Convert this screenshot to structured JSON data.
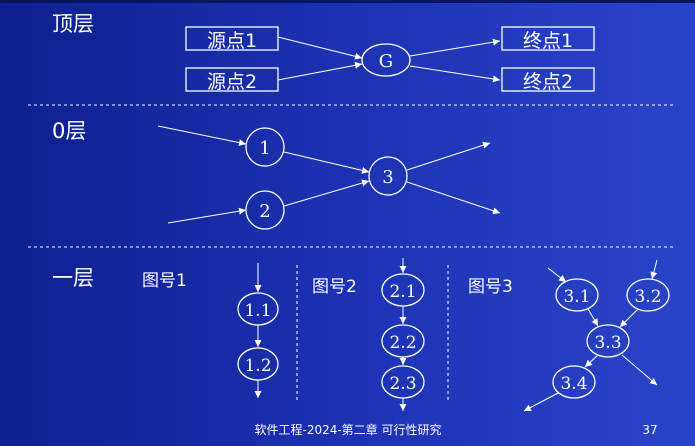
{
  "sections": {
    "top": "顶层",
    "zero": "0层",
    "one": "一层"
  },
  "top_level": {
    "source1": "源点1",
    "source2": "源点2",
    "process": "G",
    "sink1": "终点1",
    "sink2": "终点2"
  },
  "level0": {
    "nodes": [
      "1",
      "2",
      "3"
    ]
  },
  "level1": {
    "fig1": {
      "title": "图号1",
      "nodes": [
        "1.1",
        "1.2"
      ]
    },
    "fig2": {
      "title": "图号2",
      "nodes": [
        "2.1",
        "2.2",
        "2.3"
      ]
    },
    "fig3": {
      "title": "图号3",
      "nodes": [
        "3.1",
        "3.2",
        "3.3",
        "3.4"
      ]
    }
  },
  "footer": {
    "caption": "软件工程-2024-第二章 可行性研究",
    "page": "37"
  },
  "colors": {
    "background": "#1a2fae",
    "foreground": "#ffffff"
  }
}
